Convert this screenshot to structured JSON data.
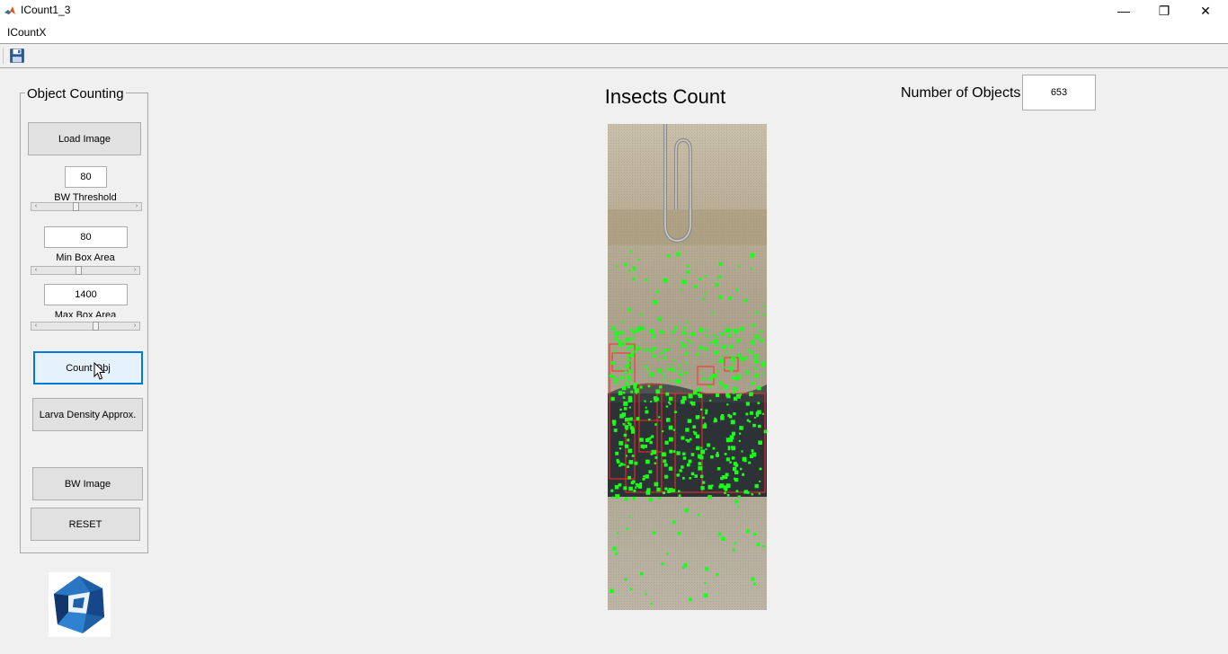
{
  "window": {
    "title": "ICount1_3",
    "minimize": "—",
    "maximize": "❐",
    "close": "✕"
  },
  "menu": {
    "items": [
      "ICountX"
    ]
  },
  "toolbar": {
    "save_icon": "save-icon"
  },
  "panel": {
    "title": "Object Counting",
    "load_image": "Load Image",
    "bw_threshold": {
      "value": "80",
      "label": "BW Threshold",
      "slider_fraction": 0.38
    },
    "min_box_area": {
      "value": "80",
      "label": "Min Box Area",
      "slider_fraction": 0.42
    },
    "max_box_area": {
      "value": "1400",
      "label": "Max Box Area",
      "slider_fraction": 0.62
    },
    "count_obj": "Count Obj",
    "larva_density": "Larva Density Approx.",
    "bw_image": "BW Image",
    "reset": "RESET"
  },
  "plot": {
    "title": "Insects Count"
  },
  "result": {
    "label": "Number of Objects",
    "value": "653"
  },
  "colors": {
    "marker": "#1aff1a",
    "box": "#ff2a2a",
    "focus": "#0078d7"
  }
}
